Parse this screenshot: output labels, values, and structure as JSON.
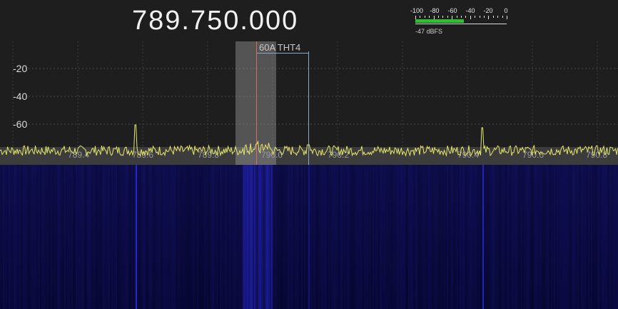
{
  "receiver": {
    "frequency": "789.750.000"
  },
  "smeter": {
    "ticks": [
      "-100",
      "-80",
      "-60",
      "-40",
      "-20",
      "0"
    ],
    "level_dbfs": -47,
    "readout": "-47 dBFS",
    "bar_color": "#2ec02e"
  },
  "spectrum": {
    "y_axis_labels": [
      "-20",
      "-40",
      "-60"
    ],
    "x_axis_labels": [
      "789.4",
      "789.6",
      "789.8",
      "790.0",
      "790.2",
      "790.4",
      "790.6",
      "790.8"
    ],
    "bookmark_label": "60A THT4",
    "trace_color": "#e6e66a"
  },
  "colors": {
    "background": "#1e1e1e",
    "waterfall_base": "#0a0a3a",
    "waterfall_signal": "#2a2ad8"
  }
}
